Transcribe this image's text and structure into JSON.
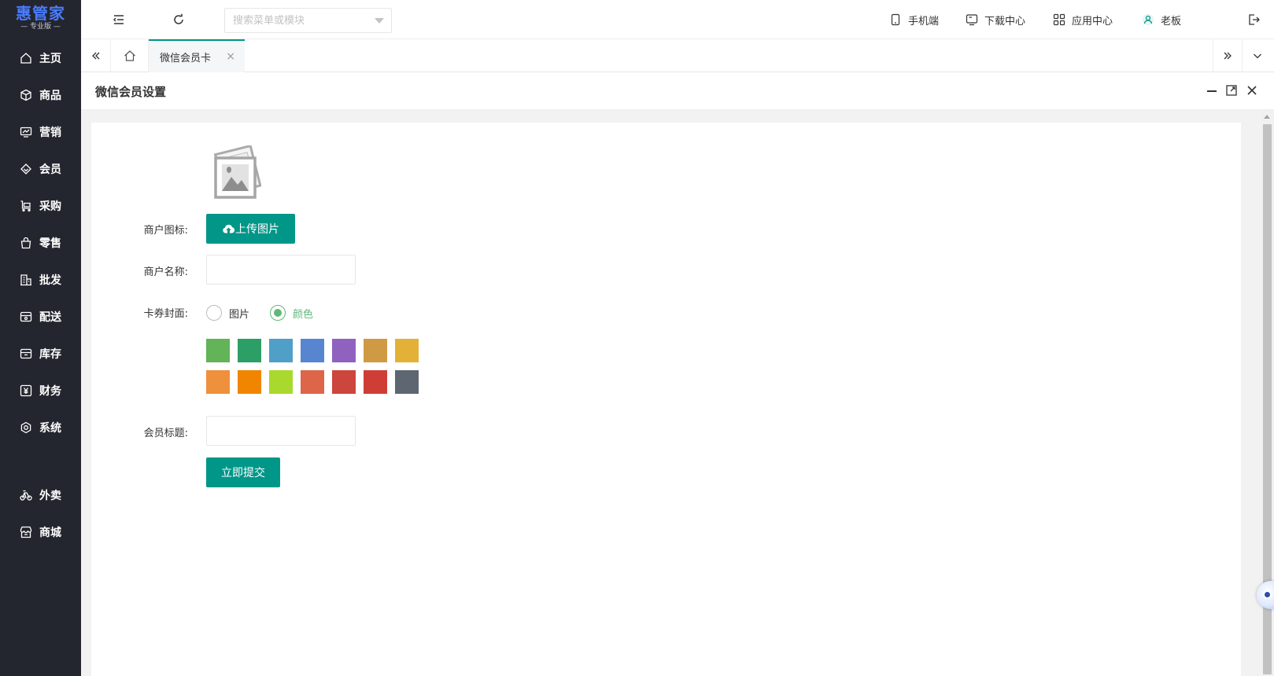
{
  "app": {
    "logo_text": "惠管家",
    "logo_sub": "— 专业版 —"
  },
  "sidebar": {
    "items": [
      {
        "label": "主页",
        "icon": "home-icon"
      },
      {
        "label": "商品",
        "icon": "cube-icon"
      },
      {
        "label": "营销",
        "icon": "chart-icon"
      },
      {
        "label": "会员",
        "icon": "diamond-icon"
      },
      {
        "label": "采购",
        "icon": "cart-icon"
      },
      {
        "label": "零售",
        "icon": "bag-icon"
      },
      {
        "label": "批发",
        "icon": "building-icon"
      },
      {
        "label": "配送",
        "icon": "delivery-icon"
      },
      {
        "label": "库存",
        "icon": "inbox-icon"
      },
      {
        "label": "财务",
        "icon": "yen-icon"
      },
      {
        "label": "系统",
        "icon": "settings-icon"
      },
      {
        "label": "外卖",
        "icon": "bike-icon"
      },
      {
        "label": "商城",
        "icon": "store-icon"
      }
    ]
  },
  "header": {
    "search_placeholder": "搜索菜单或模块",
    "links": {
      "mobile": "手机端",
      "download": "下载中心",
      "apps": "应用中心",
      "user": "老板"
    }
  },
  "tabs": {
    "active_label": "微信会员卡",
    "close_symbol": "×"
  },
  "panel": {
    "title": "微信会员设置"
  },
  "form": {
    "merchant_icon_label": "商户图标:",
    "upload_button": "上传图片",
    "merchant_name_label": "商户名称:",
    "merchant_name_value": "",
    "card_cover_label": "卡券封面:",
    "cover_options": [
      "图片",
      "颜色"
    ],
    "cover_selected": "颜色",
    "colors": [
      "#63b359",
      "#2c9f67",
      "#509fc9",
      "#5885cf",
      "#9062c0",
      "#d09a45",
      "#e4b138",
      "#ee903c",
      "#f08500",
      "#a9d92d",
      "#dd6549",
      "#cc463d",
      "#cf3e36",
      "#5e6671"
    ],
    "member_title_label": "会员标题:",
    "member_title_value": "",
    "submit_button": "立即提交"
  },
  "accent_color": "#009688"
}
